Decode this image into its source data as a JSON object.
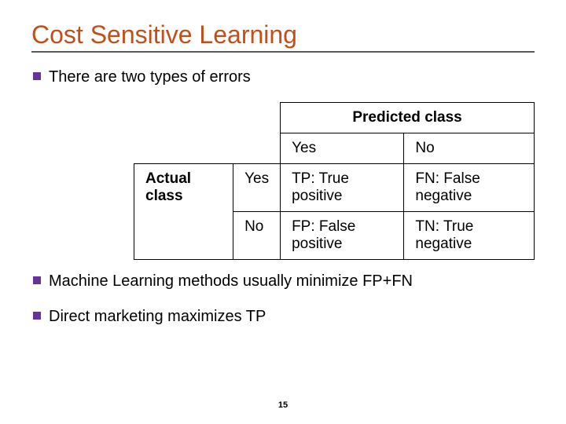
{
  "title": "Cost Sensitive Learning",
  "bullet1": "There are two types of errors",
  "bullet2": "Machine Learning methods usually minimize FP+FN",
  "bullet3": "Direct marketing maximizes TP",
  "table": {
    "predicted_header": "Predicted class",
    "col_yes": "Yes",
    "col_no": "No",
    "actual_header": "Actual class",
    "row_yes": "Yes",
    "row_no": "No",
    "tp": "TP: True positive",
    "fn": "FN: False negative",
    "fp": "FP: False positive",
    "tn": "TN: True negative"
  },
  "page_number": "15"
}
